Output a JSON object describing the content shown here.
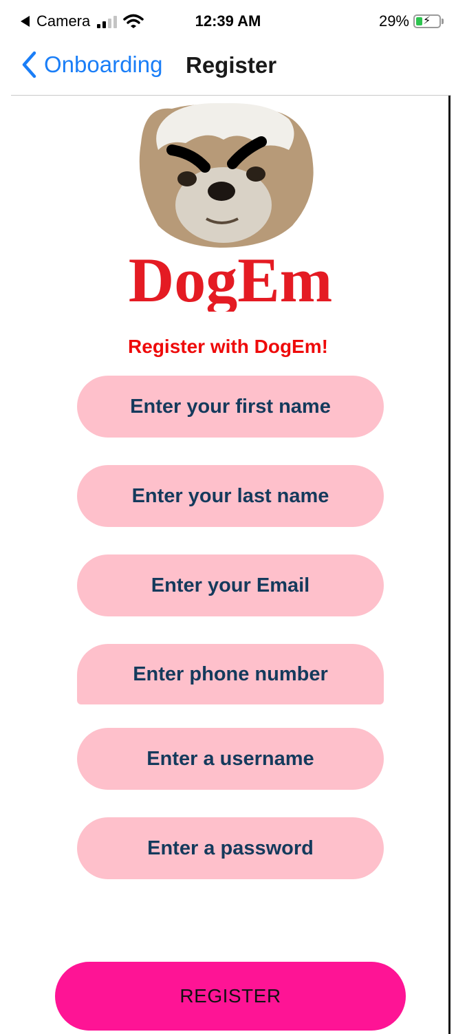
{
  "status_bar": {
    "back_app": "Camera",
    "time": "12:39 AM",
    "battery_percent_label": "29%",
    "battery_level": 0.29,
    "signal_bars_active": 2,
    "signal_bars_total": 4
  },
  "nav": {
    "back_label": "Onboarding",
    "title": "Register"
  },
  "logo": {
    "text": "DogEm"
  },
  "form": {
    "heading": "Register with DogEm!",
    "fields": [
      {
        "placeholder": "Enter your first name"
      },
      {
        "placeholder": "Enter your last name"
      },
      {
        "placeholder": "Enter your Email"
      },
      {
        "placeholder": "Enter phone number"
      },
      {
        "placeholder": "Enter a username"
      },
      {
        "placeholder": "Enter a password"
      }
    ],
    "submit_label": "REGISTER"
  },
  "colors": {
    "link_blue": "#1a7ef7",
    "heading_red": "#ee0a0a",
    "field_pink": "#fec0cb",
    "field_text": "#143a5c",
    "button_pink": "#fe1495",
    "logo_red": "#e41b23"
  }
}
